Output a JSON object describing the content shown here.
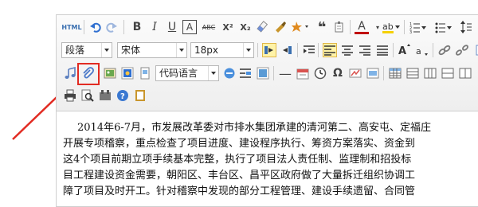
{
  "toolbar": {
    "row1": {
      "html_label": "HTML",
      "bold": "B",
      "italic": "I",
      "underline": "U",
      "border_letter": "A",
      "strike": "ABC",
      "superscript": "X²",
      "subscript": "X₂",
      "quote": "❝",
      "font_color": "A",
      "icons": [
        "html-icon",
        "undo-icon",
        "redo-icon",
        "bold-icon",
        "italic-icon",
        "underline-icon",
        "font-border-icon",
        "strikethrough-icon",
        "superscript-icon",
        "subscript-icon",
        "eraser-icon",
        "format-painter-icon",
        "auto-format-icon",
        "blockquote-icon",
        "pastetext-icon",
        "font-color-icon",
        "background-color-icon",
        "ordered-list-icon",
        "unordered-list-icon"
      ]
    },
    "row2": {
      "paragraph_value": "段落",
      "font_value": "宋体",
      "size_value": "18px"
    },
    "row3": {
      "code_lang_value": "代码语言"
    }
  },
  "content": {
    "lines": [
      "2014年6-7月，市发展改革委对市排水集团承建的清河第二、高安屯、定福庄",
      "开展专项稽察，重点检查了项目进度、建设程序执行、筹资方案落实、资金到",
      "这4个项目前期立项手续基本完整，执行了项目法人责任制、监理制和招投标",
      "目工程建设资金需要，朝阳区、丰台区、昌平区政府做了大量拆迁组织协调工",
      "障了项目及时开工。针对稽察中发现的部分工程管理、建设手续遗留、合同管"
    ]
  },
  "colors": {
    "highlight": "#e22b22",
    "active_button": "#fff3a8",
    "toolbar_bg": "#f1f1f1"
  }
}
